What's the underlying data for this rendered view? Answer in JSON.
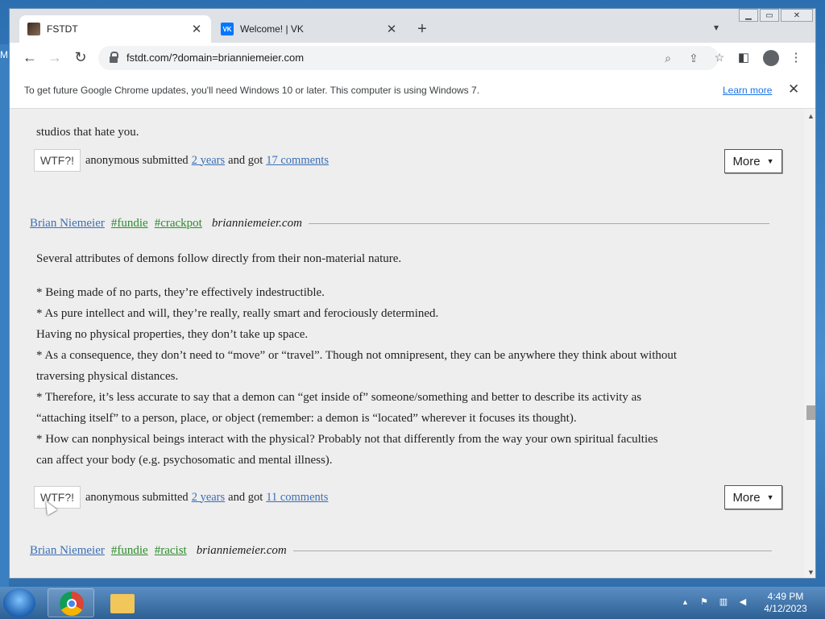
{
  "desktop": {
    "edge_letter": "M"
  },
  "tabs": [
    {
      "label": "FSTDT",
      "active": true
    },
    {
      "label": "Welcome! | VK",
      "active": false
    }
  ],
  "toolbar": {
    "url": "fstdt.com/?domain=brianniemeier.com"
  },
  "infobar": {
    "message": "To get future Google Chrome updates, you'll need Windows 10 or later. This computer is using Windows 7.",
    "learn_more": "Learn more"
  },
  "posts": [
    {
      "tail_text": "studios that hate you.",
      "wtf": "WTF?!",
      "submitter": "anonymous submitted",
      "age": "2 years",
      "and_got": "and got",
      "comments": "17 comments",
      "more": "More"
    },
    {
      "author": "Brian Niemeier",
      "tags": [
        "#fundie",
        "#crackpot"
      ],
      "domain": "brianniemeier.com",
      "paragraph1": "Several attributes of demons follow directly from their non-material nature.",
      "lines": [
        "* Being made of no parts, they’re effectively indestructible.",
        "* As pure intellect and will, they’re really, really smart and ferociously determined.",
        "Having no physical properties, they don’t take up space.",
        "* As a consequence, they don’t need to “move” or “travel”. Though not omnipresent, they can be anywhere they think about without",
        "traversing physical distances.",
        "* Therefore, it’s less accurate to say that a demon can “get inside of” someone/something and better to describe its activity as",
        "“attaching itself” to a person, place, or object (remember: a demon is “located” wherever it focuses its thought).",
        "* How can nonphysical beings interact with the physical? Probably not that differently from the way your own spiritual faculties",
        "can affect your body (e.g. psychosomatic and mental illness)."
      ],
      "wtf": "WTF?!",
      "submitter": "anonymous submitted",
      "age": "2 years",
      "and_got": "and got",
      "comments": "11 comments",
      "more": "More"
    },
    {
      "author": "Brian Niemeier",
      "tags": [
        "#fundie",
        "#racist"
      ],
      "domain": "brianniemeier.com"
    }
  ],
  "clock": {
    "time": "4:49 PM",
    "date": "4/12/2023"
  }
}
